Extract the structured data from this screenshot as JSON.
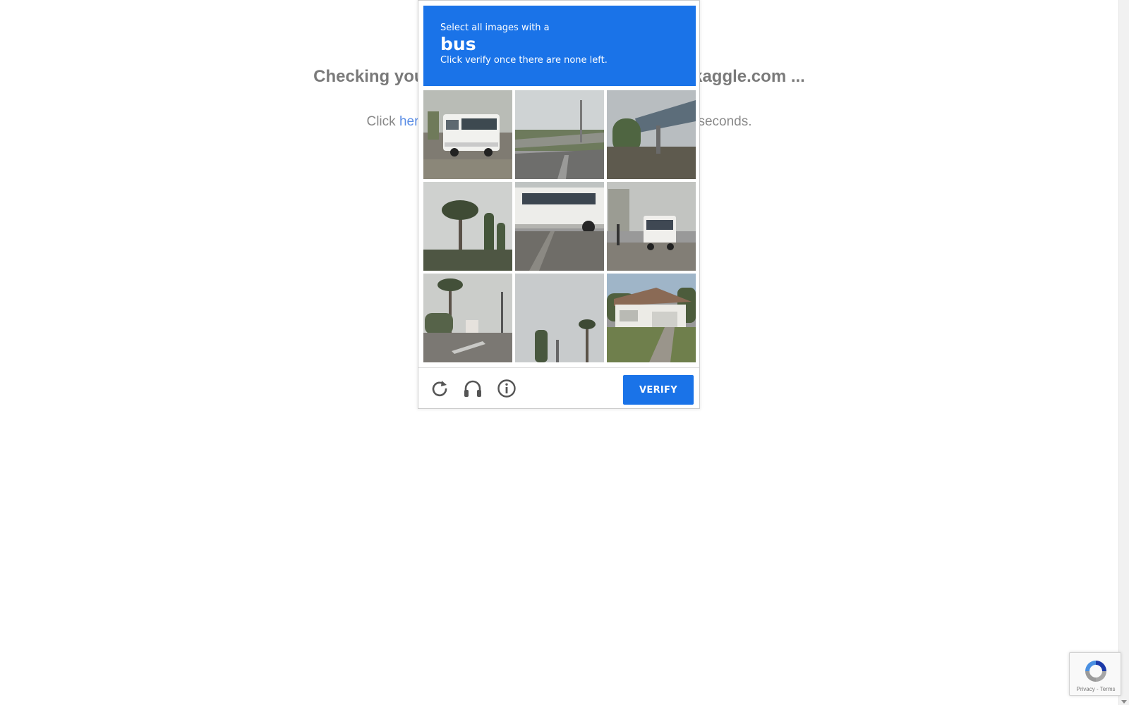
{
  "page": {
    "heading": "Checking your browser before accessing www.kaggle.com ...",
    "sub_before": "Click ",
    "sub_link": "here",
    "sub_after": " if you are not automatically redirected after 5 seconds."
  },
  "captcha": {
    "instruction_line1": "Select all images with a",
    "keyword": "bus",
    "instruction_line2": "Click verify once there are none left.",
    "verify_label": "VERIFY",
    "accent_color": "#1a73e8",
    "tiles": [
      {
        "subject": "bus"
      },
      {
        "subject": "highway overpass"
      },
      {
        "subject": "bridge"
      },
      {
        "subject": "palm trees"
      },
      {
        "subject": "bus"
      },
      {
        "subject": "bus"
      },
      {
        "subject": "palm trees"
      },
      {
        "subject": "palm tree"
      },
      {
        "subject": "house"
      }
    ],
    "icons": [
      "reload-icon",
      "headphones-icon",
      "info-icon"
    ]
  },
  "badge": {
    "privacy": "Privacy",
    "separator": " - ",
    "terms": "Terms"
  }
}
